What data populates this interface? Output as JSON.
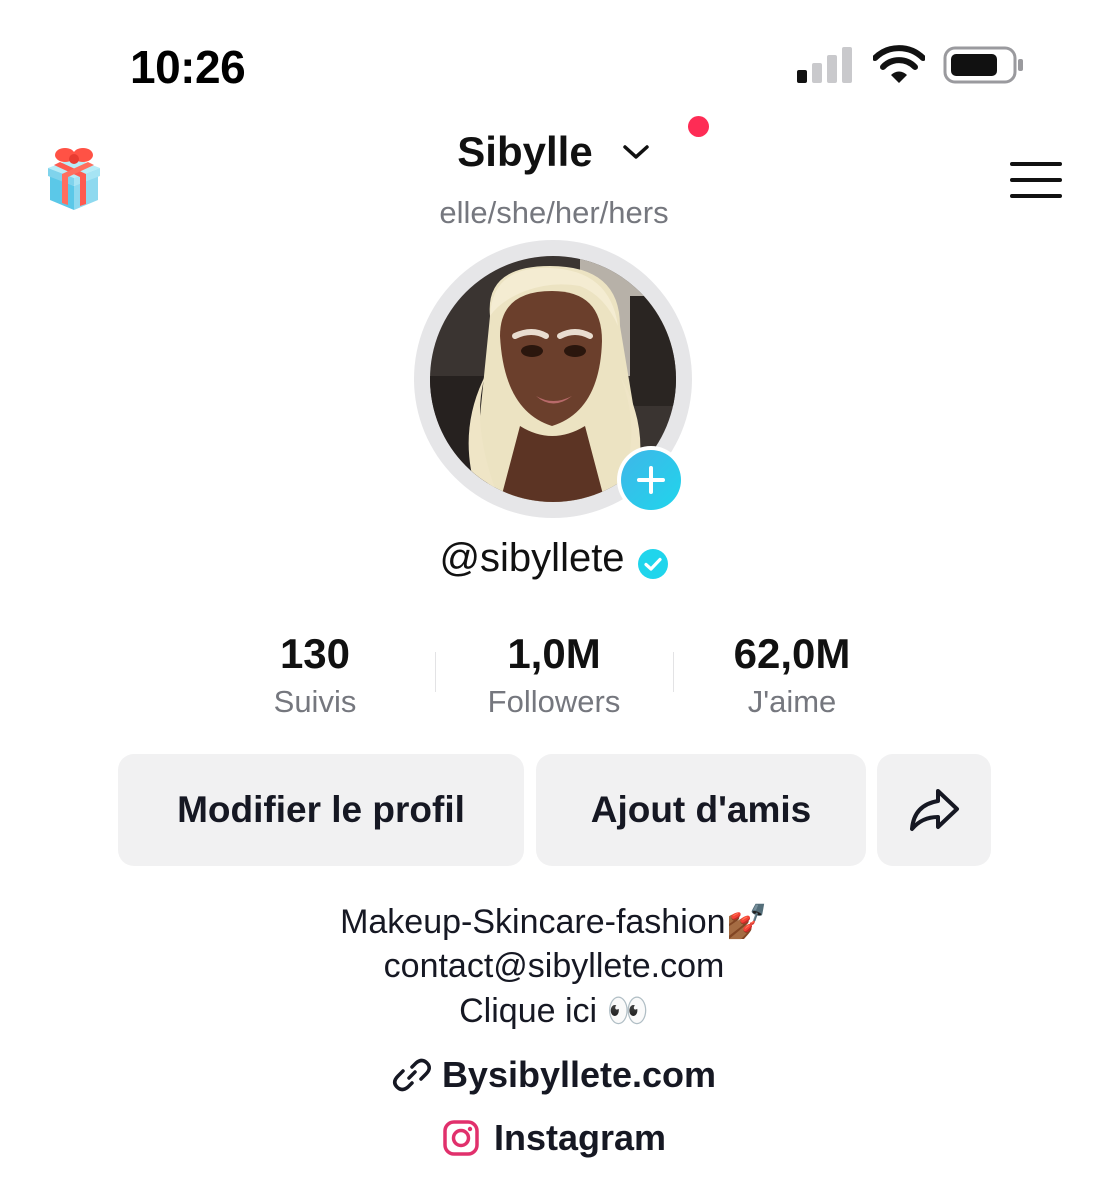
{
  "status_bar": {
    "time": "10:26"
  },
  "profile": {
    "display_name": "Sibylle",
    "pronouns": "elle/she/her/hers",
    "handle": "@sibyllete"
  },
  "stats": [
    {
      "value": "130",
      "label": "Suivis"
    },
    {
      "value": "1,0M",
      "label": "Followers"
    },
    {
      "value": "62,0M",
      "label": "J'aime"
    }
  ],
  "actions": {
    "edit_profile": "Modifier le profil",
    "add_friends": "Ajout d'amis"
  },
  "bio": {
    "line1": "Makeup-Skincare-fashion💅🏾",
    "line2": "contact@sibyllete.com",
    "line3": "Clique ici 👀"
  },
  "links": {
    "website": "Bysibyllete.com",
    "instagram": "Instagram"
  },
  "colors": {
    "notification_dot": "#fe2c55",
    "verified": "#20d5ec",
    "button_bg": "#f1f1f2",
    "secondary_text": "#75777e"
  }
}
